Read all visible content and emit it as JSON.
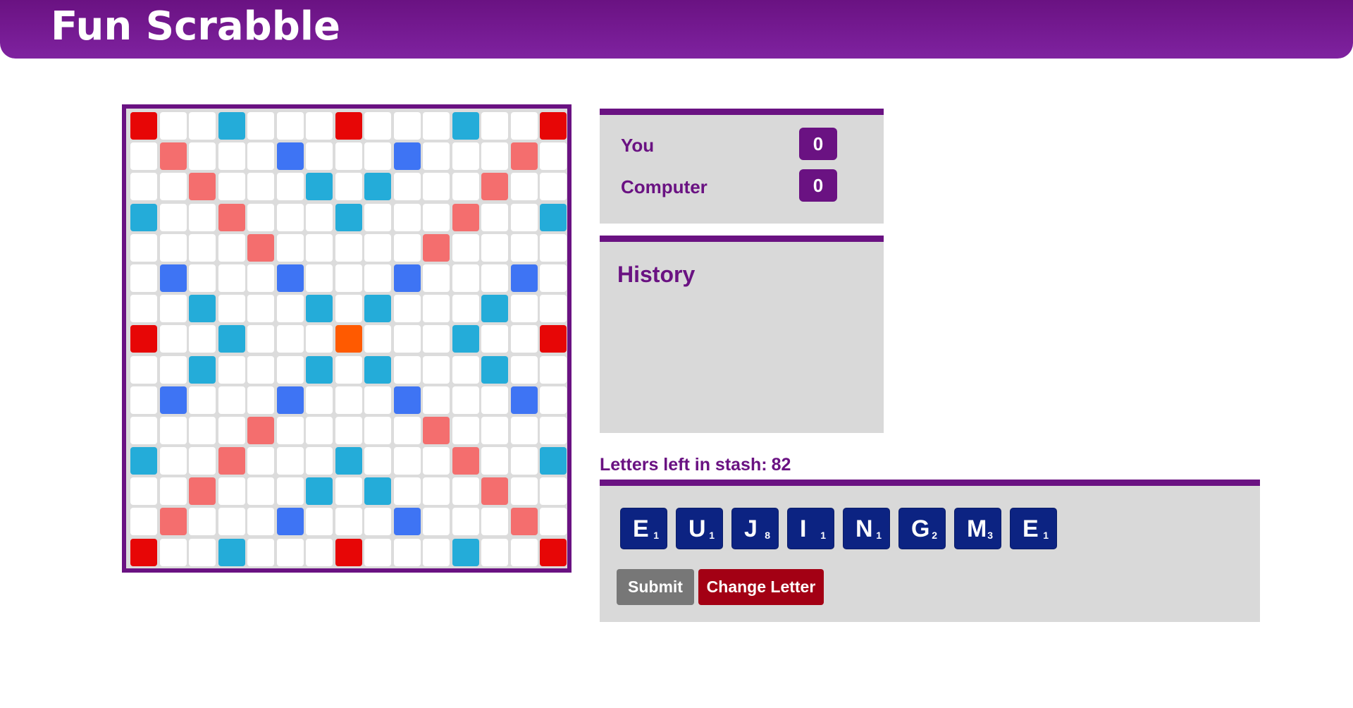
{
  "app": {
    "title": "Fun Scrabble"
  },
  "colors": {
    "brand": "#6a1282",
    "triple_word": "#e70606",
    "double_word": "#f46e6e",
    "triple_letter": "#3e74f4",
    "double_letter": "#24acd9",
    "start": "#ff5a00",
    "tile": "#0c2382",
    "submit": "#777777",
    "change_letter": "#a30014"
  },
  "board": {
    "size": 15,
    "legend": {
      "tw": "triple-word",
      "dw": "double-word",
      "tl": "triple-letter",
      "dl": "double-letter",
      "st": "start",
      ".": "empty"
    },
    "rows": [
      [
        "tw",
        ".",
        ".",
        "dl",
        ".",
        ".",
        ".",
        "tw",
        ".",
        ".",
        ".",
        "dl",
        ".",
        ".",
        "tw"
      ],
      [
        ".",
        "dw",
        ".",
        ".",
        ".",
        "tl",
        ".",
        ".",
        ".",
        "tl",
        ".",
        ".",
        ".",
        "dw",
        "."
      ],
      [
        ".",
        ".",
        "dw",
        ".",
        ".",
        ".",
        "dl",
        ".",
        "dl",
        ".",
        ".",
        ".",
        "dw",
        ".",
        "."
      ],
      [
        "dl",
        ".",
        ".",
        "dw",
        ".",
        ".",
        ".",
        "dl",
        ".",
        ".",
        ".",
        "dw",
        ".",
        ".",
        "dl"
      ],
      [
        ".",
        ".",
        ".",
        ".",
        "dw",
        ".",
        ".",
        ".",
        ".",
        ".",
        "dw",
        ".",
        ".",
        ".",
        "."
      ],
      [
        ".",
        "tl",
        ".",
        ".",
        ".",
        "tl",
        ".",
        ".",
        ".",
        "tl",
        ".",
        ".",
        ".",
        "tl",
        "."
      ],
      [
        ".",
        ".",
        "dl",
        ".",
        ".",
        ".",
        "dl",
        ".",
        "dl",
        ".",
        ".",
        ".",
        "dl",
        ".",
        "."
      ],
      [
        "tw",
        ".",
        ".",
        "dl",
        ".",
        ".",
        ".",
        "st",
        ".",
        ".",
        ".",
        "dl",
        ".",
        ".",
        "tw"
      ],
      [
        ".",
        ".",
        "dl",
        ".",
        ".",
        ".",
        "dl",
        ".",
        "dl",
        ".",
        ".",
        ".",
        "dl",
        ".",
        "."
      ],
      [
        ".",
        "tl",
        ".",
        ".",
        ".",
        "tl",
        ".",
        ".",
        ".",
        "tl",
        ".",
        ".",
        ".",
        "tl",
        "."
      ],
      [
        ".",
        ".",
        ".",
        ".",
        "dw",
        ".",
        ".",
        ".",
        ".",
        ".",
        "dw",
        ".",
        ".",
        ".",
        "."
      ],
      [
        "dl",
        ".",
        ".",
        "dw",
        ".",
        ".",
        ".",
        "dl",
        ".",
        ".",
        ".",
        "dw",
        ".",
        ".",
        "dl"
      ],
      [
        ".",
        ".",
        "dw",
        ".",
        ".",
        ".",
        "dl",
        ".",
        "dl",
        ".",
        ".",
        ".",
        "dw",
        ".",
        "."
      ],
      [
        ".",
        "dw",
        ".",
        ".",
        ".",
        "tl",
        ".",
        ".",
        ".",
        "tl",
        ".",
        ".",
        ".",
        "dw",
        "."
      ],
      [
        "tw",
        ".",
        ".",
        "dl",
        ".",
        ".",
        ".",
        "tw",
        ".",
        ".",
        ".",
        "dl",
        ".",
        ".",
        "tw"
      ]
    ]
  },
  "scores": [
    {
      "name": "You",
      "score": "0"
    },
    {
      "name": "Computer",
      "score": "0"
    }
  ],
  "history": {
    "title": "History",
    "entries": []
  },
  "stash": {
    "label": "Letters left in stash:",
    "count": "82"
  },
  "rack": {
    "tiles": [
      {
        "letter": "E",
        "score": "1"
      },
      {
        "letter": "U",
        "score": "1"
      },
      {
        "letter": "J",
        "score": "8"
      },
      {
        "letter": "I",
        "score": "1"
      },
      {
        "letter": "N",
        "score": "1"
      },
      {
        "letter": "G",
        "score": "2"
      },
      {
        "letter": "M",
        "score": "3"
      },
      {
        "letter": "E",
        "score": "1"
      }
    ]
  },
  "actions": {
    "submit_label": "Submit",
    "change_letter_label": "Change Letter"
  }
}
